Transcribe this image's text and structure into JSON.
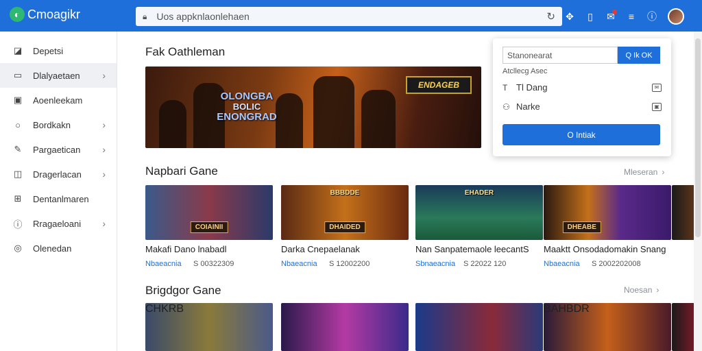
{
  "app": {
    "name": "Cmoagikr"
  },
  "address": {
    "value": "Uos appknlaonlehaen"
  },
  "sidebar": {
    "items": [
      {
        "label": "Depetsi",
        "icon": "dashboard-icon",
        "chevron": false
      },
      {
        "label": "Dlalyaetaen",
        "icon": "window-icon",
        "chevron": true,
        "active": true
      },
      {
        "label": "Aoenleekam",
        "icon": "image-icon",
        "chevron": false
      },
      {
        "label": "Bordkakn",
        "icon": "circle-icon",
        "chevron": true
      },
      {
        "label": "Pargaetican",
        "icon": "pencil-icon",
        "chevron": true
      },
      {
        "label": "Dragerlacan",
        "icon": "gallery-icon",
        "chevron": true
      },
      {
        "label": "Dentanlmaren",
        "icon": "grid-icon",
        "chevron": false
      },
      {
        "label": "Rragaeloani",
        "icon": "info-icon",
        "chevron": true
      },
      {
        "label": "Olenedan",
        "icon": "settings-icon",
        "chevron": false
      }
    ]
  },
  "main": {
    "featured_title": "Fak Oathleman",
    "hero": {
      "line1": "OLONGBA",
      "line2": "BOLIC",
      "line3": "ENONGRAD",
      "logo": "ENDAGEB"
    },
    "section1": {
      "title": "Napbari Gane",
      "more": "Mleseran",
      "cards": [
        {
          "title": "Makafi Dano lnabadl",
          "m1": "Nbaeacnia",
          "m2": "S 00322309",
          "thumb": "COIAINII",
          "toptag": ""
        },
        {
          "title": "Darka Cnepaelanak",
          "m1": "Nbaeacnia",
          "m2": "S 12002200",
          "thumb": "DHAIDED",
          "toptag": "BBBDDE"
        },
        {
          "title": "Nan Sanpatemaole leecantS",
          "m1": "Sbnaeacnia",
          "m2": "S 22022 120",
          "thumb": "",
          "toptag": "EHADER"
        },
        {
          "title": "Maaktt Onsodadomakin Snang",
          "m1": "Nbaeacnia",
          "m2": "S 2002202008",
          "thumb": "DHEABE",
          "toptag": ""
        }
      ]
    },
    "section2": {
      "title": "Brigdgor Gane",
      "more": "Noesan",
      "cards": [
        {
          "toptag": "CHKRB"
        },
        {
          "toptag": ""
        },
        {
          "toptag": ""
        },
        {
          "toptag": "BAHBDR"
        }
      ]
    }
  },
  "panel": {
    "input_value": "Stanonearat",
    "search_btn": "Q Ik OK",
    "label": "Atcllecg Asec",
    "row1": "Tl Dang",
    "row2": "Narke",
    "primary_btn": "O Intiak"
  },
  "colors": {
    "accent": "#1e6fd9",
    "topbar": "#1e6fd9"
  }
}
